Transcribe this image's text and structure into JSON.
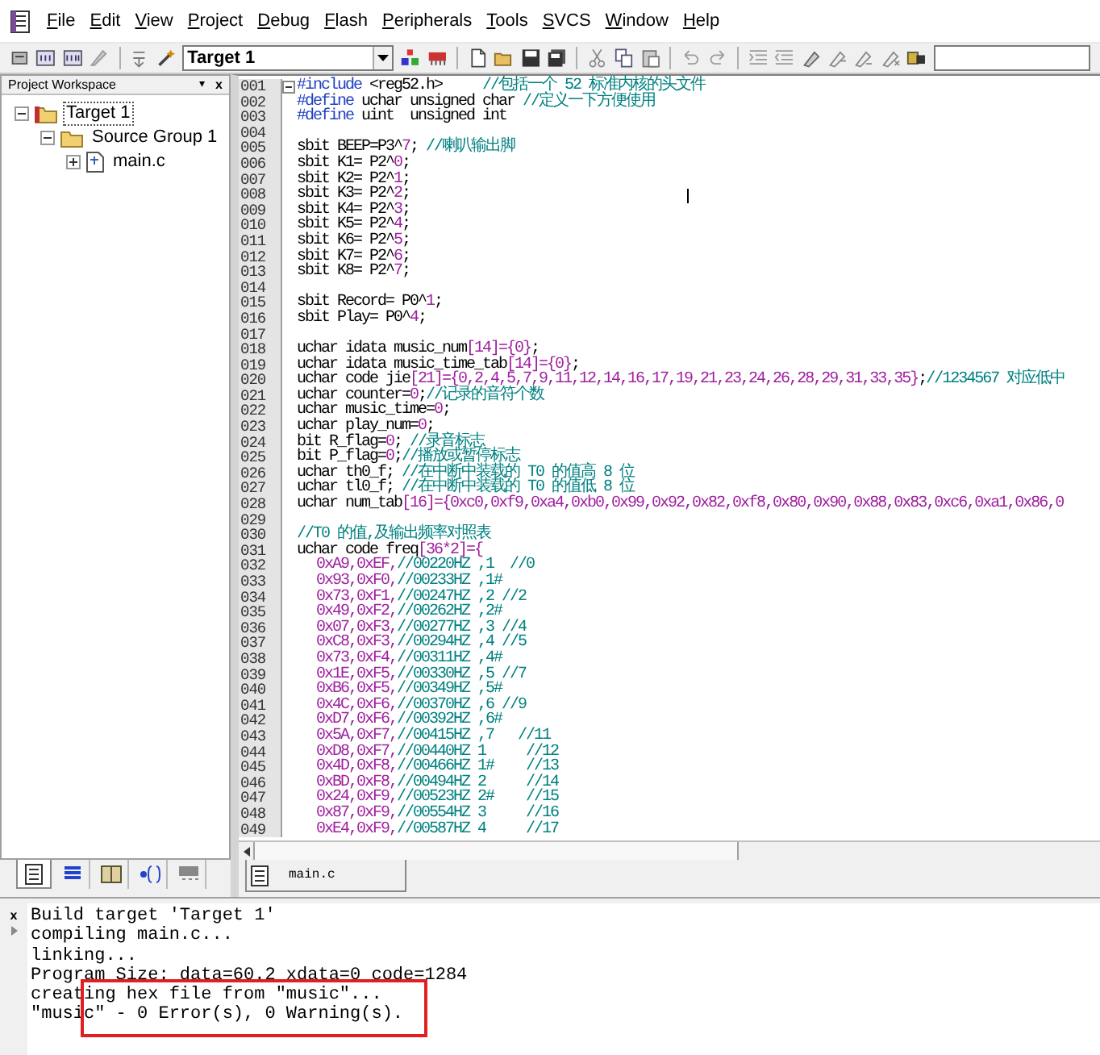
{
  "menu": [
    "File",
    "Edit",
    "View",
    "Project",
    "Debug",
    "Flash",
    "Peripherals",
    "Tools",
    "SVCS",
    "Window",
    "Help"
  ],
  "toolbar": {
    "target": "Target 1"
  },
  "workspace": {
    "title": "Project Workspace",
    "close": "x",
    "pin": "▾",
    "tree": [
      {
        "label": "Target 1",
        "expanded": true,
        "selected": true,
        "children": [
          {
            "label": "Source Group 1",
            "expanded": true,
            "children": [
              {
                "label": "main.c",
                "expanded": false
              }
            ]
          }
        ]
      }
    ],
    "tabs": [
      {
        "selected": true
      },
      {
        "selected": false
      },
      {
        "selected": false
      },
      {
        "selected": false
      },
      {
        "selected": false
      }
    ]
  },
  "editor": {
    "tabs": [
      {
        "label": "main.c",
        "selected": true
      }
    ],
    "lines": [
      {
        "number": "001",
        "indented": false,
        "segments": [
          {
            "kind": "directive",
            "text": "#include"
          },
          {
            "kind": "plain",
            "text": " <reg52.h>     "
          },
          {
            "kind": "comment",
            "text": "//包括一个 52 标准内核的头文件"
          }
        ]
      },
      {
        "number": "002",
        "indented": false,
        "segments": [
          {
            "kind": "directive",
            "text": "#define"
          },
          {
            "kind": "plain",
            "text": " uchar unsigned char "
          },
          {
            "kind": "comment",
            "text": "//定义一下方便使用"
          }
        ]
      },
      {
        "number": "003",
        "indented": false,
        "segments": [
          {
            "kind": "directive",
            "text": "#define"
          },
          {
            "kind": "plain",
            "text": " uint  unsigned int"
          }
        ]
      },
      {
        "number": "004"
      },
      {
        "number": "005",
        "indented": false,
        "segments": [
          {
            "kind": "plain",
            "text": "sbit BEEP=P3^"
          },
          {
            "kind": "number",
            "text": "7"
          },
          {
            "kind": "plain",
            "text": "; "
          },
          {
            "kind": "comment",
            "text": "//喇叭输出脚"
          }
        ]
      },
      {
        "number": "006",
        "indented": false,
        "segments": [
          {
            "kind": "plain",
            "text": "sbit K1= P2^"
          },
          {
            "kind": "number",
            "text": "0"
          },
          {
            "kind": "plain",
            "text": ";"
          }
        ]
      },
      {
        "number": "007",
        "indented": false,
        "segments": [
          {
            "kind": "plain",
            "text": "sbit K2= P2^"
          },
          {
            "kind": "number",
            "text": "1"
          },
          {
            "kind": "plain",
            "text": ";"
          }
        ]
      },
      {
        "number": "008",
        "indented": false,
        "segments": [
          {
            "kind": "plain",
            "text": "sbit K3= P2^"
          },
          {
            "kind": "number",
            "text": "2"
          },
          {
            "kind": "plain",
            "text": ";"
          }
        ]
      },
      {
        "number": "009",
        "indented": false,
        "segments": [
          {
            "kind": "plain",
            "text": "sbit K4= P2^"
          },
          {
            "kind": "number",
            "text": "3"
          },
          {
            "kind": "plain",
            "text": ";"
          }
        ]
      },
      {
        "number": "010",
        "indented": false,
        "segments": [
          {
            "kind": "plain",
            "text": "sbit K5= P2^"
          },
          {
            "kind": "number",
            "text": "4"
          },
          {
            "kind": "plain",
            "text": ";"
          }
        ]
      },
      {
        "number": "011",
        "indented": false,
        "segments": [
          {
            "kind": "plain",
            "text": "sbit K6= P2^"
          },
          {
            "kind": "number",
            "text": "5"
          },
          {
            "kind": "plain",
            "text": ";"
          }
        ]
      },
      {
        "number": "012",
        "indented": false,
        "segments": [
          {
            "kind": "plain",
            "text": "sbit K7= P2^"
          },
          {
            "kind": "number",
            "text": "6"
          },
          {
            "kind": "plain",
            "text": ";"
          }
        ]
      },
      {
        "number": "013",
        "indented": false,
        "segments": [
          {
            "kind": "plain",
            "text": "sbit K8= P2^"
          },
          {
            "kind": "number",
            "text": "7"
          },
          {
            "kind": "plain",
            "text": ";"
          }
        ]
      },
      {
        "number": "014"
      },
      {
        "number": "015",
        "indented": false,
        "segments": [
          {
            "kind": "plain",
            "text": "sbit Record= P0^"
          },
          {
            "kind": "number",
            "text": "1"
          },
          {
            "kind": "plain",
            "text": ";"
          }
        ]
      },
      {
        "number": "016",
        "indented": false,
        "segments": [
          {
            "kind": "plain",
            "text": "sbit Play= P0^"
          },
          {
            "kind": "number",
            "text": "4"
          },
          {
            "kind": "plain",
            "text": ";"
          }
        ]
      },
      {
        "number": "017"
      },
      {
        "number": "018",
        "indented": false,
        "segments": [
          {
            "kind": "plain",
            "text": "uchar idata music_num"
          },
          {
            "kind": "number",
            "text": "[14]={0}"
          },
          {
            "kind": "plain",
            "text": ";"
          }
        ]
      },
      {
        "number": "019",
        "indented": false,
        "segments": [
          {
            "kind": "plain",
            "text": "uchar idata music_time_tab"
          },
          {
            "kind": "number",
            "text": "[14]={0}"
          },
          {
            "kind": "plain",
            "text": ";"
          }
        ]
      },
      {
        "number": "020",
        "indented": false,
        "segments": [
          {
            "kind": "plain",
            "text": "uchar code jie"
          },
          {
            "kind": "number",
            "text": "[21]={0,2,4,5,7,9,11,12,14,16,17,19,21,23,24,26,28,29,31,33,35}"
          },
          {
            "kind": "plain",
            "text": ";"
          },
          {
            "kind": "comment",
            "text": "//1234567 对应低中"
          }
        ]
      },
      {
        "number": "021",
        "indented": false,
        "segments": [
          {
            "kind": "plain",
            "text": "uchar counter="
          },
          {
            "kind": "number",
            "text": "0"
          },
          {
            "kind": "plain",
            "text": ";"
          },
          {
            "kind": "comment",
            "text": "//记录的音符个数"
          }
        ]
      },
      {
        "number": "022",
        "indented": false,
        "segments": [
          {
            "kind": "plain",
            "text": "uchar music_time="
          },
          {
            "kind": "number",
            "text": "0"
          },
          {
            "kind": "plain",
            "text": ";"
          }
        ]
      },
      {
        "number": "023",
        "indented": false,
        "segments": [
          {
            "kind": "plain",
            "text": "uchar play_num="
          },
          {
            "kind": "number",
            "text": "0"
          },
          {
            "kind": "plain",
            "text": ";"
          }
        ]
      },
      {
        "number": "024",
        "indented": false,
        "segments": [
          {
            "kind": "plain",
            "text": "bit R_flag="
          },
          {
            "kind": "number",
            "text": "0"
          },
          {
            "kind": "plain",
            "text": "; "
          },
          {
            "kind": "comment",
            "text": "//录音标志"
          }
        ]
      },
      {
        "number": "025",
        "indented": false,
        "segments": [
          {
            "kind": "plain",
            "text": "bit P_flag="
          },
          {
            "kind": "number",
            "text": "0"
          },
          {
            "kind": "plain",
            "text": ";"
          },
          {
            "kind": "comment",
            "text": "//播放或暂停标志"
          }
        ]
      },
      {
        "number": "026",
        "indented": false,
        "segments": [
          {
            "kind": "plain",
            "text": "uchar th0_f; "
          },
          {
            "kind": "comment",
            "text": "//在中断中装载的 T0 的值高 8 位"
          }
        ]
      },
      {
        "number": "027",
        "indented": false,
        "segments": [
          {
            "kind": "plain",
            "text": "uchar tl0_f; "
          },
          {
            "kind": "comment",
            "text": "//在中断中装载的 T0 的值低 8 位"
          }
        ]
      },
      {
        "number": "028",
        "indented": false,
        "segments": [
          {
            "kind": "plain",
            "text": "uchar num_tab"
          },
          {
            "kind": "number",
            "text": "[16]={0xc0,0xf9,0xa4,0xb0,0x99,0x92,0x82,0xf8,0x80,0x90,0x88,0x83,0xc6,0xa1,0x86,0"
          }
        ]
      },
      {
        "number": "029"
      },
      {
        "number": "030",
        "indented": false,
        "segments": [
          {
            "kind": "comment",
            "text": "//T0 的值,及输出频率对照表"
          }
        ]
      },
      {
        "number": "031",
        "indented": false,
        "segments": [
          {
            "kind": "plain",
            "text": "uchar code freq"
          },
          {
            "kind": "number",
            "text": "[36*2]={"
          }
        ]
      },
      {
        "number": "032",
        "indented": true,
        "segments": [
          {
            "kind": "number",
            "text": "0xA9,0xEF,"
          },
          {
            "kind": "comment",
            "text": "//00220HZ ,1  //0"
          }
        ]
      },
      {
        "number": "033",
        "indented": true,
        "segments": [
          {
            "kind": "number",
            "text": "0x93,0xF0,"
          },
          {
            "kind": "comment",
            "text": "//00233HZ ,1#"
          }
        ]
      },
      {
        "number": "034",
        "indented": true,
        "segments": [
          {
            "kind": "number",
            "text": "0x73,0xF1,"
          },
          {
            "kind": "comment",
            "text": "//00247HZ ,2 //2"
          }
        ]
      },
      {
        "number": "035",
        "indented": true,
        "segments": [
          {
            "kind": "number",
            "text": "0x49,0xF2,"
          },
          {
            "kind": "comment",
            "text": "//00262HZ ,2#"
          }
        ]
      },
      {
        "number": "036",
        "indented": true,
        "segments": [
          {
            "kind": "number",
            "text": "0x07,0xF3,"
          },
          {
            "kind": "comment",
            "text": "//00277HZ ,3 //4"
          }
        ]
      },
      {
        "number": "037",
        "indented": true,
        "segments": [
          {
            "kind": "number",
            "text": "0xC8,0xF3,"
          },
          {
            "kind": "comment",
            "text": "//00294HZ ,4 //5"
          }
        ]
      },
      {
        "number": "038",
        "indented": true,
        "segments": [
          {
            "kind": "number",
            "text": "0x73,0xF4,"
          },
          {
            "kind": "comment",
            "text": "//00311HZ ,4#"
          }
        ]
      },
      {
        "number": "039",
        "indented": true,
        "segments": [
          {
            "kind": "number",
            "text": "0x1E,0xF5,"
          },
          {
            "kind": "comment",
            "text": "//00330HZ ,5 //7"
          }
        ]
      },
      {
        "number": "040",
        "indented": true,
        "segments": [
          {
            "kind": "number",
            "text": "0xB6,0xF5,"
          },
          {
            "kind": "comment",
            "text": "//00349HZ ,5#"
          }
        ]
      },
      {
        "number": "041",
        "indented": true,
        "segments": [
          {
            "kind": "number",
            "text": "0x4C,0xF6,"
          },
          {
            "kind": "comment",
            "text": "//00370HZ ,6 //9"
          }
        ]
      },
      {
        "number": "042",
        "indented": true,
        "segments": [
          {
            "kind": "number",
            "text": "0xD7,0xF6,"
          },
          {
            "kind": "comment",
            "text": "//00392HZ ,6#"
          }
        ]
      },
      {
        "number": "043",
        "indented": true,
        "segments": [
          {
            "kind": "number",
            "text": "0x5A,0xF7,"
          },
          {
            "kind": "comment",
            "text": "//00415HZ ,7   //11"
          }
        ]
      },
      {
        "number": "044",
        "indented": true,
        "segments": [
          {
            "kind": "number",
            "text": "0xD8,0xF7,"
          },
          {
            "kind": "comment",
            "text": "//00440HZ 1     //12"
          }
        ]
      },
      {
        "number": "045",
        "indented": true,
        "segments": [
          {
            "kind": "number",
            "text": "0x4D,0xF8,"
          },
          {
            "kind": "comment",
            "text": "//00466HZ 1#    //13"
          }
        ]
      },
      {
        "number": "046",
        "indented": true,
        "segments": [
          {
            "kind": "number",
            "text": "0xBD,0xF8,"
          },
          {
            "kind": "comment",
            "text": "//00494HZ 2     //14"
          }
        ]
      },
      {
        "number": "047",
        "indented": true,
        "segments": [
          {
            "kind": "number",
            "text": "0x24,0xF9,"
          },
          {
            "kind": "comment",
            "text": "//00523HZ 2#    //15"
          }
        ]
      },
      {
        "number": "048",
        "indented": true,
        "segments": [
          {
            "kind": "number",
            "text": "0x87,0xF9,"
          },
          {
            "kind": "comment",
            "text": "//00554HZ 3     //16"
          }
        ]
      },
      {
        "number": "049",
        "indented": true,
        "segments": [
          {
            "kind": "number",
            "text": "0xE4,0xF9,"
          },
          {
            "kind": "comment",
            "text": "//00587HZ 4     //17"
          }
        ]
      }
    ]
  },
  "output": {
    "close": "x",
    "lines": [
      "Build target 'Target 1'",
      "compiling main.c...",
      "linking...",
      "Program Size: data=60.2 xdata=0 code=1284",
      "creating hex file from \"music\"...",
      "\"music\" - 0 Error(s), 0 Warning(s)."
    ]
  }
}
